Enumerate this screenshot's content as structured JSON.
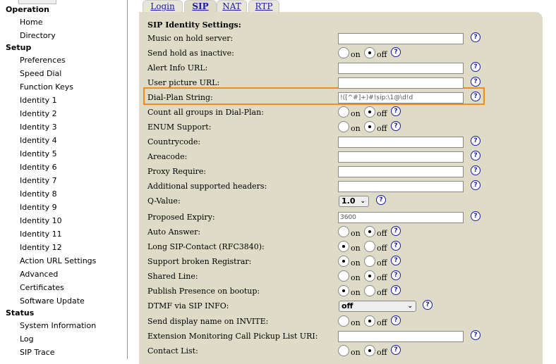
{
  "sidebar": {
    "sections": [
      {
        "title": "Operation",
        "items": [
          "Home",
          "Directory"
        ]
      },
      {
        "title": "Setup",
        "items": [
          "Preferences",
          "Speed Dial",
          "Function Keys",
          "Identity 1",
          "Identity 2",
          "Identity 3",
          "Identity 4",
          "Identity 5",
          "Identity 6",
          "Identity 7",
          "Identity 8",
          "Identity 9",
          "Identity 10",
          "Identity 11",
          "Identity 12",
          "Action URL Settings",
          "Advanced",
          "Certificates",
          "Software Update"
        ]
      },
      {
        "title": "Status",
        "items": [
          "System Information",
          "Log",
          "SIP Trace"
        ]
      }
    ]
  },
  "tabs": [
    "Login",
    "SIP",
    "NAT",
    "RTP"
  ],
  "active_tab": "SIP",
  "panel": {
    "title": "SIP Identity Settings:",
    "on_label": "on",
    "off_label": "off",
    "help_glyph": "?",
    "fields": [
      {
        "label": "Music on hold server:",
        "type": "text",
        "value": ""
      },
      {
        "label": "Send hold as inactive:",
        "type": "radio",
        "value": "off"
      },
      {
        "label": "Alert Info URL:",
        "type": "text",
        "value": ""
      },
      {
        "label": "User picture URL:",
        "type": "text",
        "value": ""
      },
      {
        "label": "Dial-Plan String:",
        "type": "text",
        "value": "!([^#]+)#!sip:\\1@\\d!d"
      },
      {
        "label": "Count all groups in Dial-Plan:",
        "type": "radio",
        "value": "off"
      },
      {
        "label": "ENUM Support:",
        "type": "radio",
        "value": "off"
      },
      {
        "label": "Countrycode:",
        "type": "text",
        "value": ""
      },
      {
        "label": "Areacode:",
        "type": "text",
        "value": ""
      },
      {
        "label": "Proxy Require:",
        "type": "text",
        "value": ""
      },
      {
        "label": "Additional supported headers:",
        "type": "text",
        "value": ""
      },
      {
        "label": "Q-Value:",
        "type": "select",
        "value": "1.0"
      },
      {
        "label": "Proposed Expiry:",
        "type": "text",
        "value": "3600"
      },
      {
        "label": "Auto Answer:",
        "type": "radio",
        "value": "off"
      },
      {
        "label": "Long SIP-Contact (RFC3840):",
        "type": "radio",
        "value": "on"
      },
      {
        "label": "Support broken Registrar:",
        "type": "radio",
        "value": "on"
      },
      {
        "label": "Shared Line:",
        "type": "radio",
        "value": "off"
      },
      {
        "label": "Publish Presence on bootup:",
        "type": "radio",
        "value": "on"
      },
      {
        "label": "DTMF via SIP INFO:",
        "type": "select",
        "value": "off"
      },
      {
        "label": "Send display name on INVITE:",
        "type": "radio",
        "value": "off"
      },
      {
        "label": "Extension Monitoring Call Pickup List URI:",
        "type": "text",
        "value": ""
      },
      {
        "label": "Contact List:",
        "type": "radio",
        "value": "off"
      }
    ]
  },
  "highlighted_field": "Dial-Plan String:",
  "colors": {
    "panel_bg": "#dedbc7",
    "tab_link": "#1a1aa6",
    "highlight": "#f08c1a"
  }
}
